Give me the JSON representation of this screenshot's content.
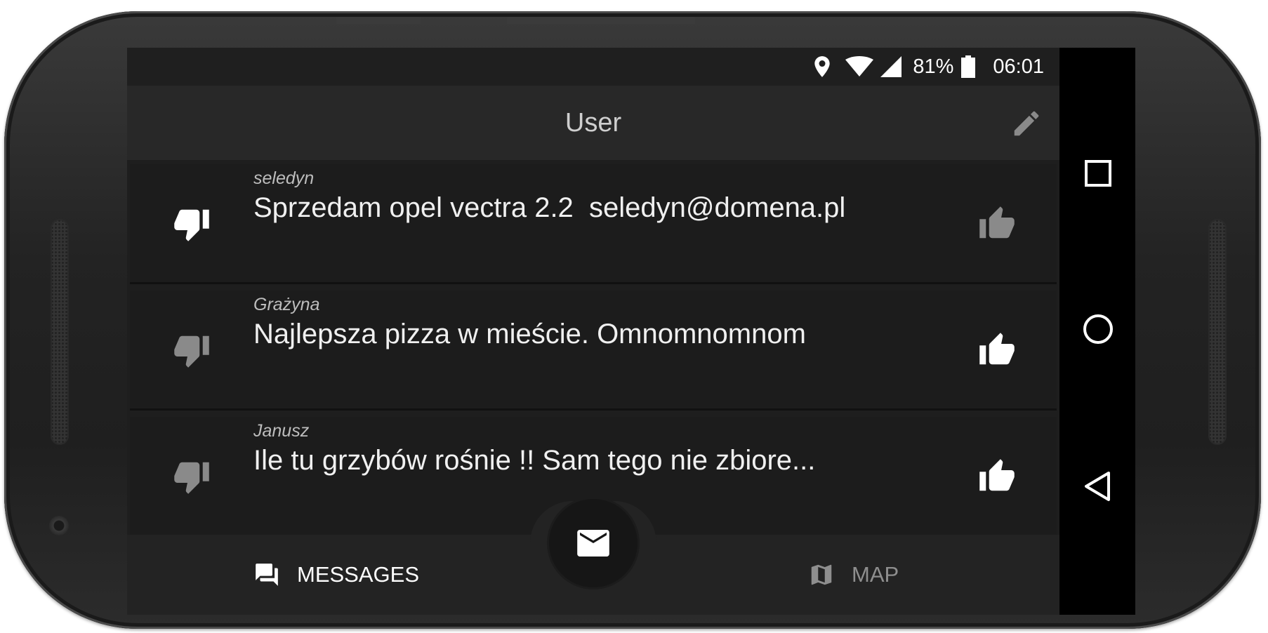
{
  "status_bar": {
    "battery_percent": "81%",
    "time": "06:01",
    "icons": [
      "location-icon",
      "wifi-icon",
      "signal-icon",
      "battery-icon"
    ]
  },
  "app_bar": {
    "title": "User",
    "edit_icon": "pencil-icon"
  },
  "messages": [
    {
      "author": "seledyn",
      "text": "Sprzedam opel vectra 2.2  seledyn@domena.pl",
      "down_active": true,
      "up_active": false
    },
    {
      "author": "Grażyna",
      "text": "Najlepsza pizza w mieście. Omnomnomnom",
      "down_active": false,
      "up_active": true
    },
    {
      "author": "Janusz",
      "text": "Ile tu grzybów rośnie !! Sam tego nie zbiore...",
      "down_active": false,
      "up_active": true
    }
  ],
  "bottom_nav": {
    "messages_label": "MESSAGES",
    "map_label": "MAP",
    "fab_icon": "envelope-icon"
  },
  "colors": {
    "active_icon": "#ffffff",
    "inactive_icon": "#8a8a8a",
    "background": "#1e1e1e",
    "app_bar": "#282828"
  }
}
